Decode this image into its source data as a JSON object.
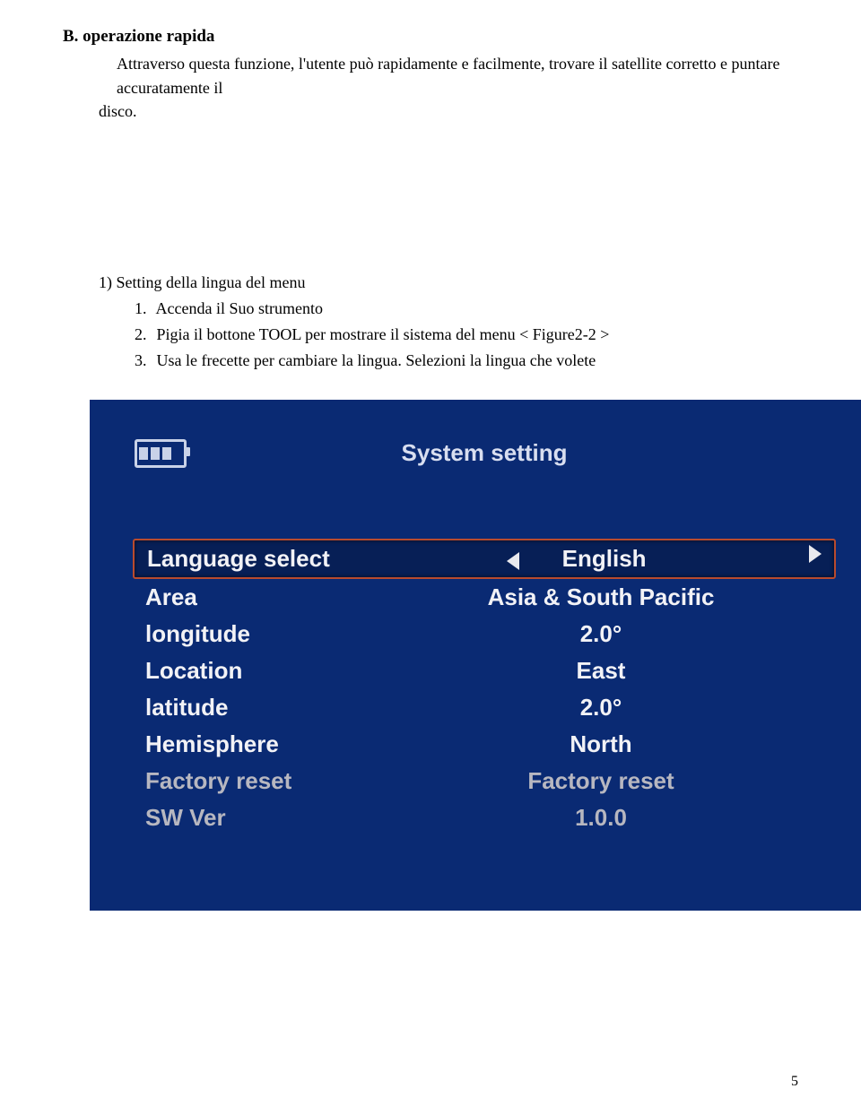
{
  "doc": {
    "section_title": "B. operazione rapida",
    "intro": "Attraverso questa funzione, l'utente può rapidamente e facilmente, trovare il satellite corretto e puntare accuratamente il",
    "intro_tail": "disco.",
    "subheading": "1) Setting della lingua del menu",
    "steps": [
      {
        "n": "1.",
        "text": "Accenda il Suo strumento"
      },
      {
        "n": "2.",
        "text": "Pigia il bottone TOOL  per mostrare il sistema del menu < Figure2-2 >"
      },
      {
        "n": "3.",
        "text": "Usa le frecette  per cambiare la lingua. Selezioni la lingua che volete"
      }
    ],
    "page_number": "5"
  },
  "screenshot": {
    "title": "System setting",
    "rows": [
      {
        "label": "Language select",
        "value": "English",
        "selected": true,
        "arrows": true,
        "dim": false
      },
      {
        "label": "Area",
        "value": "Asia & South Pacific",
        "selected": false,
        "arrows": false,
        "dim": false
      },
      {
        "label": "longitude",
        "value": "2.0°",
        "selected": false,
        "arrows": false,
        "dim": false
      },
      {
        "label": "Location",
        "value": "East",
        "selected": false,
        "arrows": false,
        "dim": false
      },
      {
        "label": "latitude",
        "value": "2.0°",
        "selected": false,
        "arrows": false,
        "dim": false
      },
      {
        "label": "Hemisphere",
        "value": "North",
        "selected": false,
        "arrows": false,
        "dim": false
      },
      {
        "label": "Factory reset",
        "value": "Factory reset",
        "selected": false,
        "arrows": false,
        "dim": true
      },
      {
        "label": "SW Ver",
        "value": "1.0.0",
        "selected": false,
        "arrows": false,
        "dim": true
      }
    ]
  }
}
